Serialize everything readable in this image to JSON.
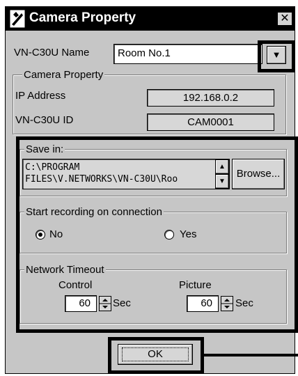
{
  "window": {
    "title": "Camera Property",
    "close_glyph": "✕"
  },
  "name_field": {
    "label": "VN-C30U Name",
    "value": "Room No.1",
    "dropdown_glyph": "▼"
  },
  "camera_group": {
    "legend": "Camera Property",
    "ip_label": "IP Address",
    "ip_value": "192.168.0.2",
    "id_label": "VN-C30U ID",
    "id_value": "CAM0001"
  },
  "save_group": {
    "legend": "Save in:",
    "path_line1": "C:\\PROGRAM",
    "path_line2": "FILES\\V.NETWORKS\\VN-C30U\\Roo",
    "browse_label": "Browse...",
    "up_glyph": "▲",
    "down_glyph": "▼"
  },
  "record_group": {
    "legend": "Start recording on connection",
    "options": [
      {
        "label": "No",
        "selected": true
      },
      {
        "label": "Yes",
        "selected": false
      }
    ]
  },
  "timeout_group": {
    "legend": "Network Timeout",
    "control_label": "Control",
    "control_value": "60",
    "picture_label": "Picture",
    "picture_value": "60",
    "unit": "Sec"
  },
  "ok_label": "OK"
}
